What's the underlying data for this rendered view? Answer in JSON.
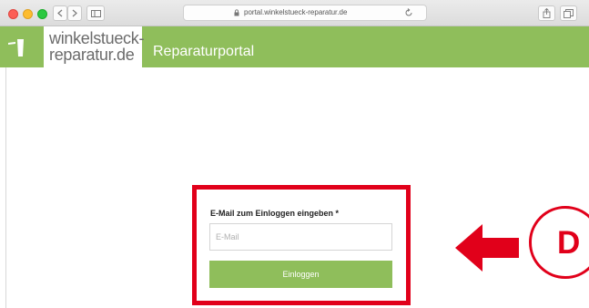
{
  "browser": {
    "url": "portal.winkelstueck-reparatur.de",
    "icons": [
      "back-icon",
      "forward-icon",
      "sidebar-icon",
      "lock-icon",
      "reload-icon",
      "share-icon",
      "tabs-icon"
    ]
  },
  "header": {
    "logo_line1": "winkelstueck-",
    "logo_line2": "reparatur.de",
    "portal_title": "Reparaturportal",
    "brand_color": "#8fbe5b"
  },
  "login": {
    "email_label": "E-Mail zum Einloggen eingeben *",
    "email_placeholder": "E-Mail",
    "email_value": "",
    "submit_label": "Einloggen"
  },
  "annotation": {
    "step_letter": "D",
    "highlight_color": "#e1001a"
  }
}
